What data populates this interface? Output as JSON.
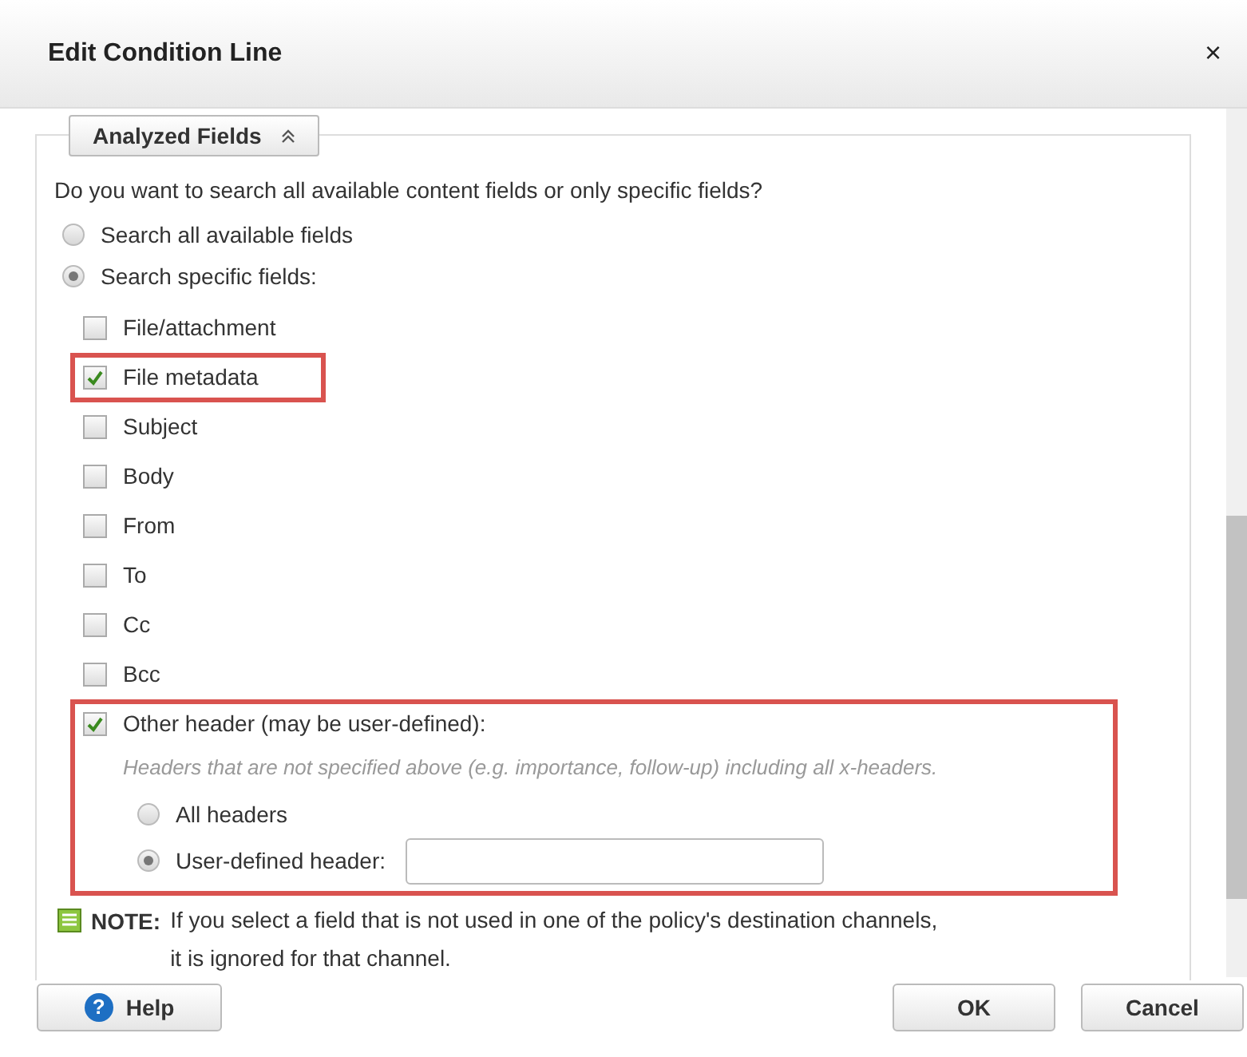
{
  "dialog": {
    "title": "Edit Condition Line",
    "close": "×"
  },
  "section": {
    "label": "Analyzed Fields",
    "expanded": true
  },
  "question": "Do you want to search all available content fields or only specific fields?",
  "scope_options": [
    {
      "label": "Search all available fields",
      "selected": false
    },
    {
      "label": "Search specific fields:",
      "selected": true
    }
  ],
  "fields": [
    {
      "label": "File/attachment",
      "checked": false,
      "highlighted": false
    },
    {
      "label": "File metadata",
      "checked": true,
      "highlighted": true
    },
    {
      "label": "Subject",
      "checked": false,
      "highlighted": false
    },
    {
      "label": "Body",
      "checked": false,
      "highlighted": false
    },
    {
      "label": "From",
      "checked": false,
      "highlighted": false
    },
    {
      "label": "To",
      "checked": false,
      "highlighted": false
    },
    {
      "label": "Cc",
      "checked": false,
      "highlighted": false
    },
    {
      "label": "Bcc",
      "checked": false,
      "highlighted": false
    },
    {
      "label": "Other header (may be user-defined):",
      "checked": true,
      "highlighted": true,
      "hint": "Headers that are not specified above (e.g. importance, follow-up) including all x-headers.",
      "header_options": [
        {
          "label": "All headers",
          "selected": false,
          "kind": "plain"
        },
        {
          "label": "User-defined header:",
          "selected": true,
          "kind": "input"
        }
      ]
    }
  ],
  "note": {
    "label": "NOTE:",
    "text": [
      "If you select a field that is not used in one of the policy's destination channels,",
      "it is ignored for that channel."
    ]
  },
  "buttons": {
    "help": "Help",
    "help_icon": "?",
    "ok": "OK",
    "cancel": "Cancel"
  }
}
